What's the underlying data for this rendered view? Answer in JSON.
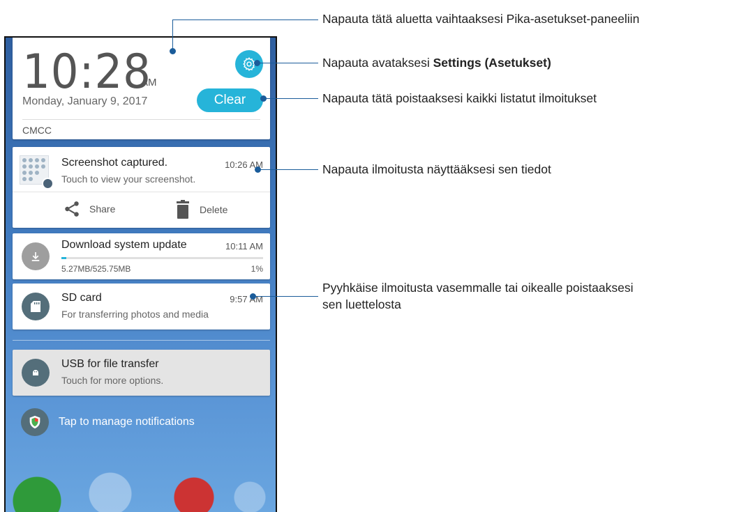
{
  "header": {
    "time": "10:28",
    "ampm": "AM",
    "date": "Monday, January 9, 2017",
    "clear_label": "Clear",
    "carrier": "CMCC"
  },
  "notifications": {
    "screenshot": {
      "title": "Screenshot captured.",
      "subtitle": "Touch to view your screenshot.",
      "time": "10:26 AM",
      "share_label": "Share",
      "delete_label": "Delete"
    },
    "download": {
      "title": "Download system update",
      "time": "10:11 AM",
      "size": "5.27MB/525.75MB",
      "percent": "1%",
      "progress": 0.01
    },
    "sd": {
      "title": "SD card",
      "subtitle": "For transferring photos and media",
      "time": "9:57 AM"
    },
    "usb": {
      "title": "USB for file transfer",
      "subtitle": "Touch for more options."
    },
    "manage_label": "Tap to manage notifications"
  },
  "callouts": {
    "quick_settings": "Napauta tätä aluetta vaihtaaksesi Pika-asetukset-paneeliin",
    "settings_prefix": "Napauta avataksesi ",
    "settings_bold": "Settings (Asetukset)",
    "clear": "Napauta tätä poistaaksesi kaikki listatut ilmoitukset",
    "details": "Napauta ilmoitusta näyttääksesi sen tiedot",
    "swipe_line1": "Pyyhkäise ilmoitusta vasemmalle tai oikealle poistaaksesi",
    "swipe_line2": "sen luettelosta"
  },
  "colors": {
    "accent": "#26b4d9",
    "callout": "#1a5c9a"
  }
}
